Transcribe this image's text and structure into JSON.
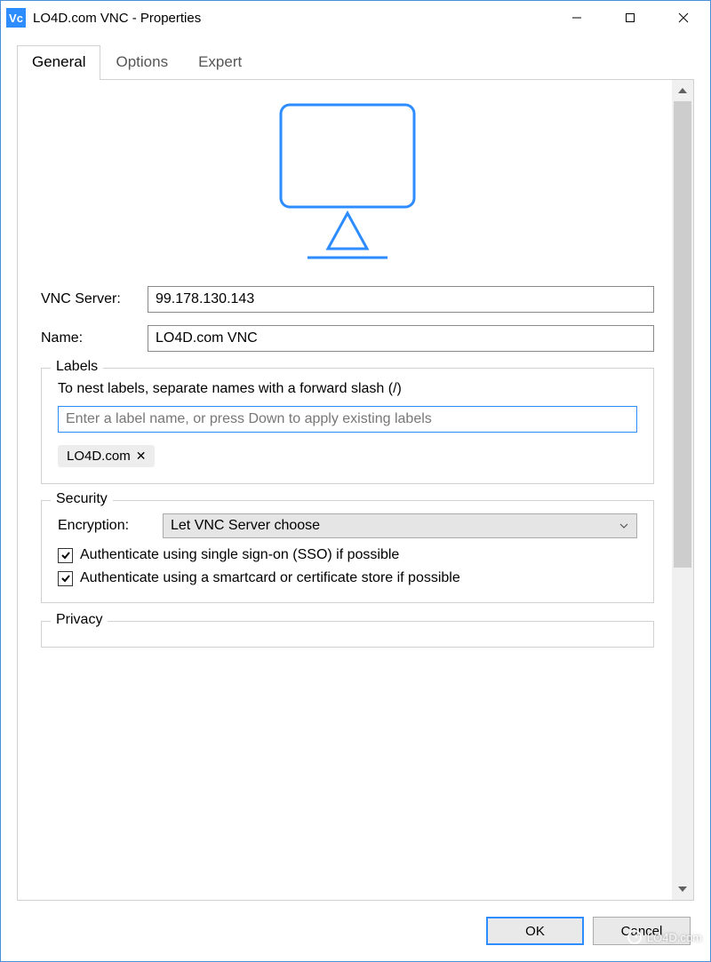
{
  "window": {
    "app_icon_text": "Vc",
    "title": "LO4D.com VNC - Properties"
  },
  "tabs": [
    {
      "label": "General",
      "active": true
    },
    {
      "label": "Options",
      "active": false
    },
    {
      "label": "Expert",
      "active": false
    }
  ],
  "general": {
    "vnc_server_label": "VNC Server:",
    "vnc_server_value": "99.178.130.143",
    "name_label": "Name:",
    "name_value": "LO4D.com VNC"
  },
  "labels_group": {
    "title": "Labels",
    "hint": "To nest labels, separate names with a forward slash (/)",
    "placeholder": "Enter a label name, or press Down to apply existing labels",
    "chips": [
      {
        "text": "LO4D.com"
      }
    ]
  },
  "security_group": {
    "title": "Security",
    "encryption_label": "Encryption:",
    "encryption_value": "Let VNC Server choose",
    "sso_label": "Authenticate using single sign-on (SSO) if possible",
    "sso_checked": true,
    "smartcard_label": "Authenticate using a smartcard or certificate store if possible",
    "smartcard_checked": true
  },
  "privacy_group": {
    "title": "Privacy"
  },
  "footer": {
    "ok": "OK",
    "cancel": "Cancel"
  },
  "watermark": "LO4D.com"
}
